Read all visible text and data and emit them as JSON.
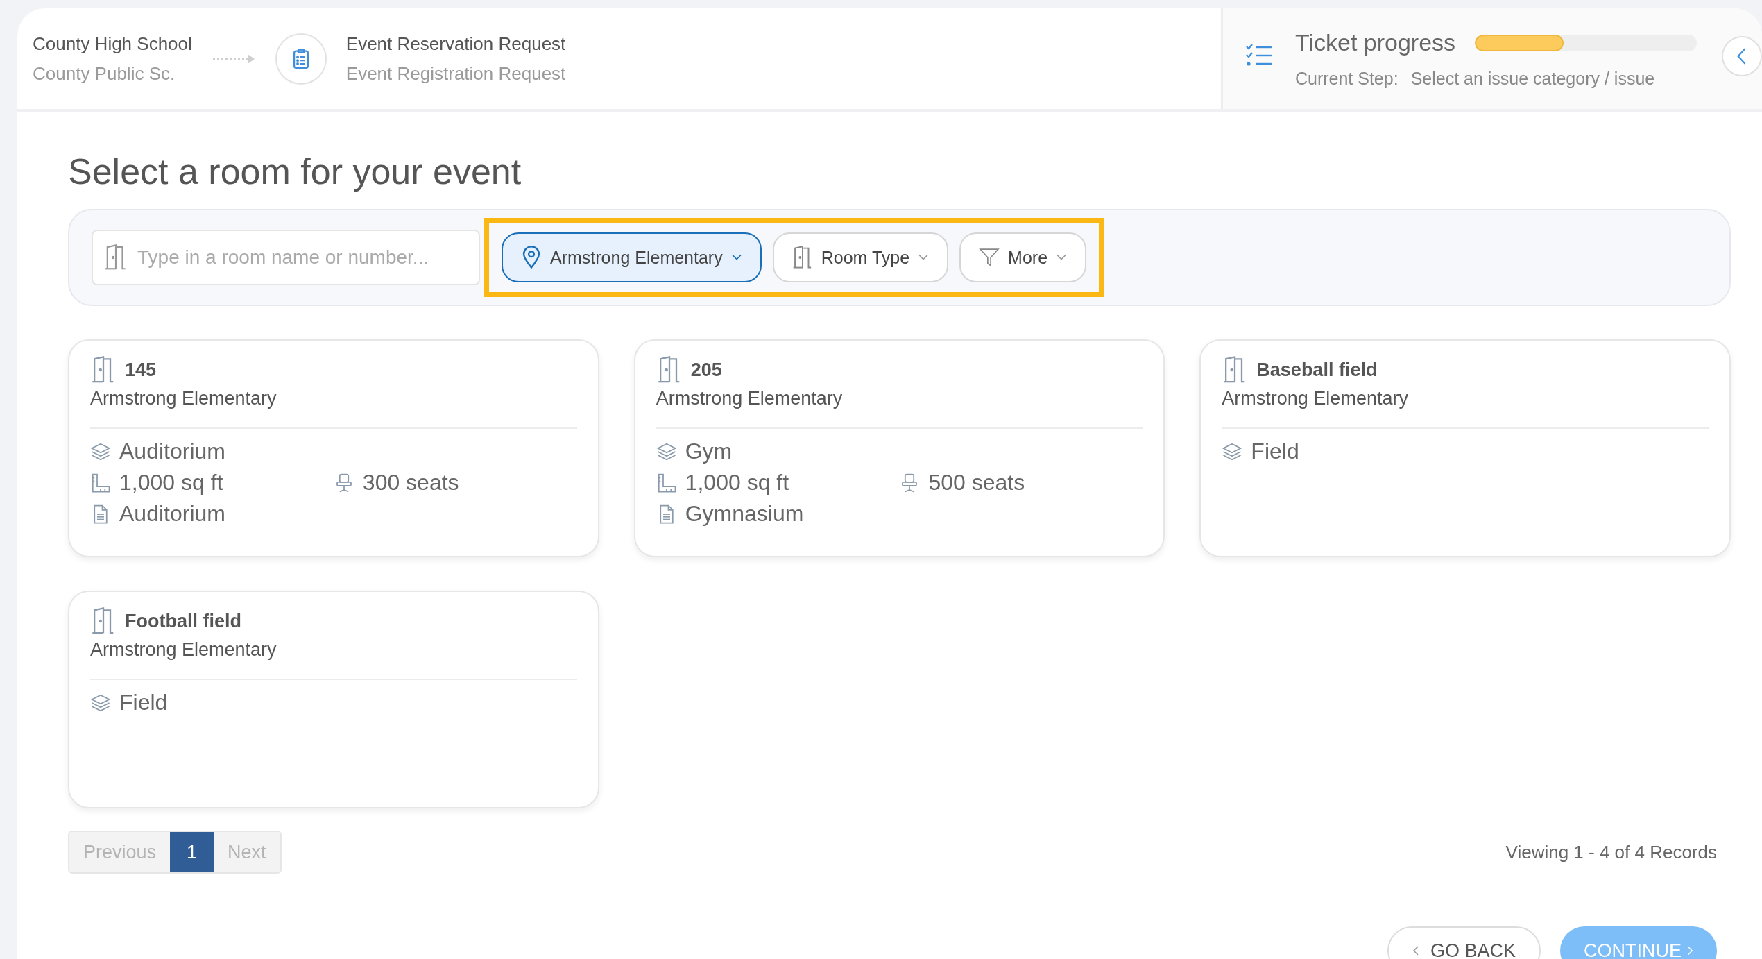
{
  "header": {
    "breadcrumb_from": [
      "County High School",
      "County Public Sc."
    ],
    "breadcrumb_to": [
      "Event Reservation Request",
      "Event Registration Request"
    ],
    "ticket_progress": {
      "title": "Ticket progress",
      "level": 0.4,
      "step_label": "Current Step:",
      "step_value": "Select an issue category / issue"
    }
  },
  "page_title": "Select a room for your event",
  "filters": {
    "search": {
      "placeholder": "Type in a room name or number..."
    },
    "highlighted": true,
    "buttons": [
      {
        "kind": "location",
        "label": "Armstrong Elementary",
        "selected": true
      },
      {
        "kind": "room",
        "label": "Room Type",
        "selected": false
      },
      {
        "kind": "filter",
        "label": "More",
        "selected": false
      }
    ]
  },
  "rooms": [
    {
      "name": "145",
      "location": "Armstrong Elementary",
      "details": [
        {
          "kind": "category",
          "text": "Auditorium"
        },
        {
          "kind": "area",
          "text": "1,000 sq ft"
        },
        {
          "kind": "seats",
          "text": "300 seats"
        },
        {
          "kind": "type",
          "text": "Auditorium"
        }
      ]
    },
    {
      "name": "205",
      "location": "Armstrong Elementary",
      "details": [
        {
          "kind": "category",
          "text": "Gym"
        },
        {
          "kind": "area",
          "text": "1,000 sq ft"
        },
        {
          "kind": "seats",
          "text": "500 seats"
        },
        {
          "kind": "type",
          "text": "Gymnasium"
        }
      ]
    },
    {
      "name": "Baseball field",
      "location": "Armstrong Elementary",
      "details": [
        {
          "kind": "category",
          "text": "Field"
        }
      ]
    },
    {
      "name": "Football field",
      "location": "Armstrong Elementary",
      "details": [
        {
          "kind": "category",
          "text": "Field"
        }
      ]
    }
  ],
  "pagination": {
    "previous": {
      "label": "Previous",
      "disabled": true
    },
    "pages": [
      {
        "label": "1",
        "selected": true
      }
    ],
    "next": {
      "label": "Next",
      "disabled": true
    }
  },
  "records": "Viewing 1 - 4 of 4 Records",
  "actions": {
    "back": "GO BACK",
    "continue": "CONTINUE"
  }
}
